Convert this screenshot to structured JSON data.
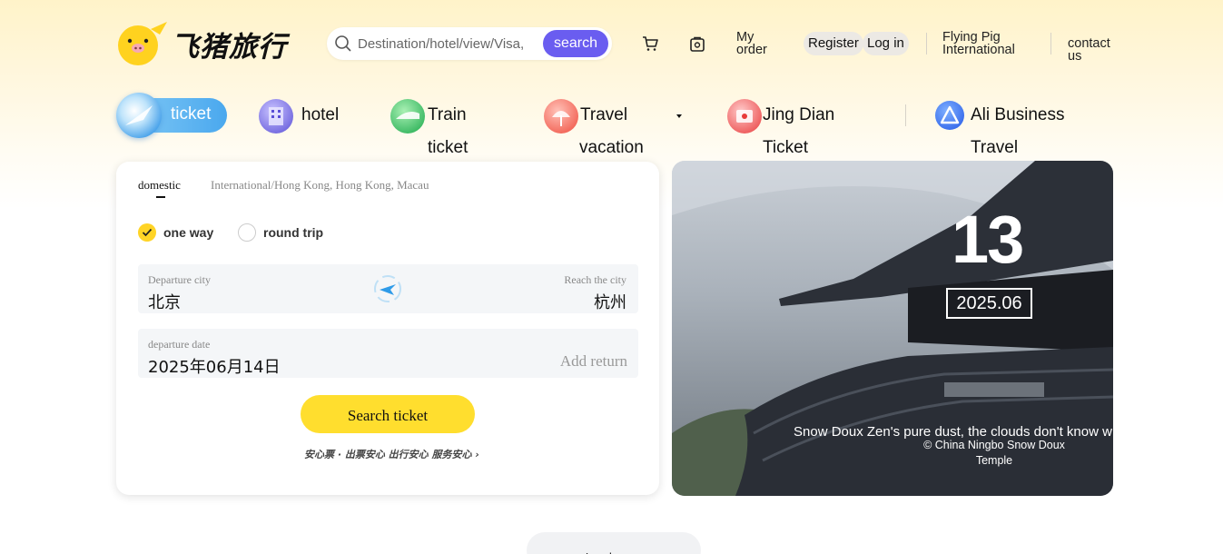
{
  "header": {
    "brand": "飞猪旅行",
    "search": {
      "placeholder": "Destination/hotel/view/Visa,",
      "button": "search"
    },
    "links": {
      "my_order": "My order",
      "register": "Register",
      "login": "Log in",
      "international": "Flying Pig International",
      "contact": "contact us"
    }
  },
  "nav": {
    "items": [
      {
        "label": "ticket",
        "active": true
      },
      {
        "label": "hotel"
      },
      {
        "label": "Train",
        "label2": "ticket"
      },
      {
        "label": "Travel",
        "label2": "vacation"
      },
      {
        "label": "Jing Dian",
        "label2": "Ticket"
      },
      {
        "label": "Ali Business",
        "label2": "Travel"
      }
    ]
  },
  "booking": {
    "tabs": [
      "domestic",
      "International/Hong Kong, Hong Kong, Macau"
    ],
    "trip_types": [
      {
        "label": "one way",
        "selected": true
      },
      {
        "label": "round trip",
        "selected": false
      }
    ],
    "departure_city_label": "Departure city",
    "departure_city": "北京",
    "arrival_city_label": "Reach the city",
    "arrival_city": "杭州",
    "departure_date_label": "departure date",
    "departure_date": "2025年06月14日",
    "add_return": "Add return",
    "search_button": "Search ticket",
    "assurance": "安心票 · 出票安心 出行安心 服务安心 ›"
  },
  "banner": {
    "day": "13",
    "year_month": "2025.06",
    "caption": "Snow Doux Zen's pure dust, the clouds don't know w",
    "location": "© China Ningbo Snow Doux Temple"
  },
  "footer": {
    "load_more": "Load more"
  },
  "colors": {
    "accent": "#6a5df0",
    "brand_yellow": "#ffd426",
    "search_ticket": "#ffde2e"
  }
}
